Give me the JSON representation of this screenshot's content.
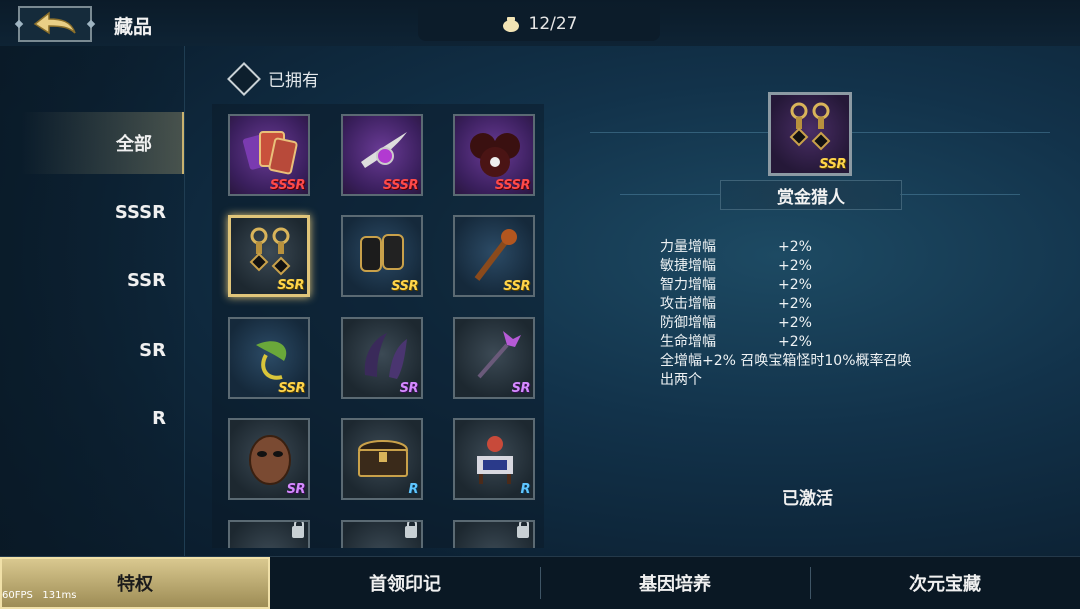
{
  "header": {
    "title": "藏品",
    "collection_count": "12/27",
    "counter_icon": "treasure-pouch-icon",
    "back_icon": "back-arrow-icon"
  },
  "sidebar": {
    "items": [
      {
        "label": "全部",
        "active": true
      },
      {
        "label": "SSSR"
      },
      {
        "label": "SSR"
      },
      {
        "label": "SR"
      },
      {
        "label": "R"
      }
    ]
  },
  "collection": {
    "section_label": "已拥有",
    "items": [
      {
        "icon": "card-deck-icon",
        "rarity": "SSSR",
        "bg": "purple"
      },
      {
        "icon": "feather-pendant-icon",
        "rarity": "SSSR",
        "bg": "purple"
      },
      {
        "icon": "skull-bombs-icon",
        "rarity": "SSSR",
        "bg": "purple"
      },
      {
        "icon": "earrings-icon",
        "rarity": "SSR",
        "bg": "dark",
        "selected": true
      },
      {
        "icon": "gauntlets-icon",
        "rarity": "SSR",
        "bg": "navy"
      },
      {
        "icon": "staff-icon",
        "rarity": "SSR",
        "bg": "navy"
      },
      {
        "icon": "vine-plant-icon",
        "rarity": "SSR",
        "bg": "navy"
      },
      {
        "icon": "horns-icon",
        "rarity": "SR",
        "bg": "dark"
      },
      {
        "icon": "scepter-icon",
        "rarity": "SR",
        "bg": "dark"
      },
      {
        "icon": "mask-icon",
        "rarity": "SR",
        "bg": "dark"
      },
      {
        "icon": "treasure-chest-icon",
        "rarity": "R",
        "bg": "dark"
      },
      {
        "icon": "shrine-table-icon",
        "rarity": "R",
        "bg": "dark"
      },
      {
        "icon": "locked-item-icon",
        "locked": true,
        "bg": "dark"
      },
      {
        "icon": "locked-item-icon",
        "locked": true,
        "bg": "dark"
      },
      {
        "icon": "locked-item-icon",
        "locked": true,
        "bg": "dark"
      }
    ]
  },
  "detail": {
    "name": "赏金猎人",
    "rarity": "SSR",
    "icon": "earrings-icon",
    "stats": [
      {
        "name": "力量增幅",
        "value": "+2%"
      },
      {
        "name": "敏捷增幅",
        "value": "+2%"
      },
      {
        "name": "智力增幅",
        "value": "+2%"
      },
      {
        "name": "攻击增幅",
        "value": "+2%"
      },
      {
        "name": "防御增幅",
        "value": "+2%"
      },
      {
        "name": "生命增幅",
        "value": "+2%"
      }
    ],
    "description_line1": "全增幅+2% 召唤宝箱怪时10%概率召唤",
    "description_line2": "出两个",
    "status": "已激活"
  },
  "bottom_tabs": [
    {
      "label": "特权",
      "active": true
    },
    {
      "label": "首领印记"
    },
    {
      "label": "基因培养"
    },
    {
      "label": "次元宝藏"
    }
  ],
  "debug": {
    "fps": "60FPS",
    "ms": "131ms"
  },
  "colors": {
    "accent_gold": "#e0c57a",
    "sssr": "#ff4a4a",
    "ssr": "#ffd54a",
    "sr": "#d58aff",
    "r": "#5fc6ff"
  }
}
